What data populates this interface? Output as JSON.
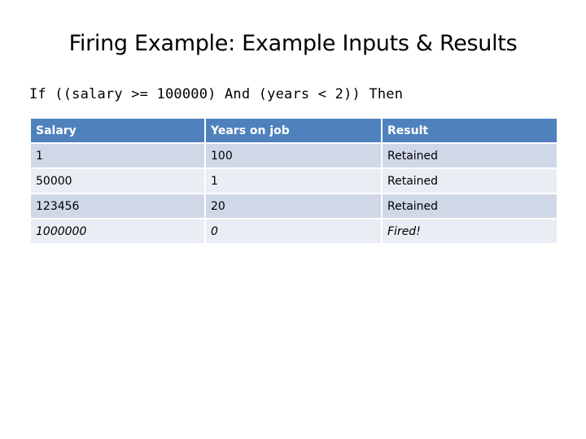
{
  "slide": {
    "title": "Firing Example: Example Inputs & Results",
    "code_line": "If ((salary >= 100000) And (years < 2)) Then"
  },
  "table": {
    "headers": [
      "Salary",
      "Years on job",
      "Result"
    ],
    "rows": [
      [
        "1",
        "100",
        "Retained"
      ],
      [
        "50000",
        "1",
        "Retained"
      ],
      [
        "123456",
        "20",
        "Retained"
      ],
      [
        "1000000",
        "0",
        "Fired!"
      ]
    ]
  },
  "colors": {
    "header_bg": "#4f81bd",
    "row_odd_bg": "#d0d8e8",
    "row_even_bg": "#e9edf4"
  }
}
